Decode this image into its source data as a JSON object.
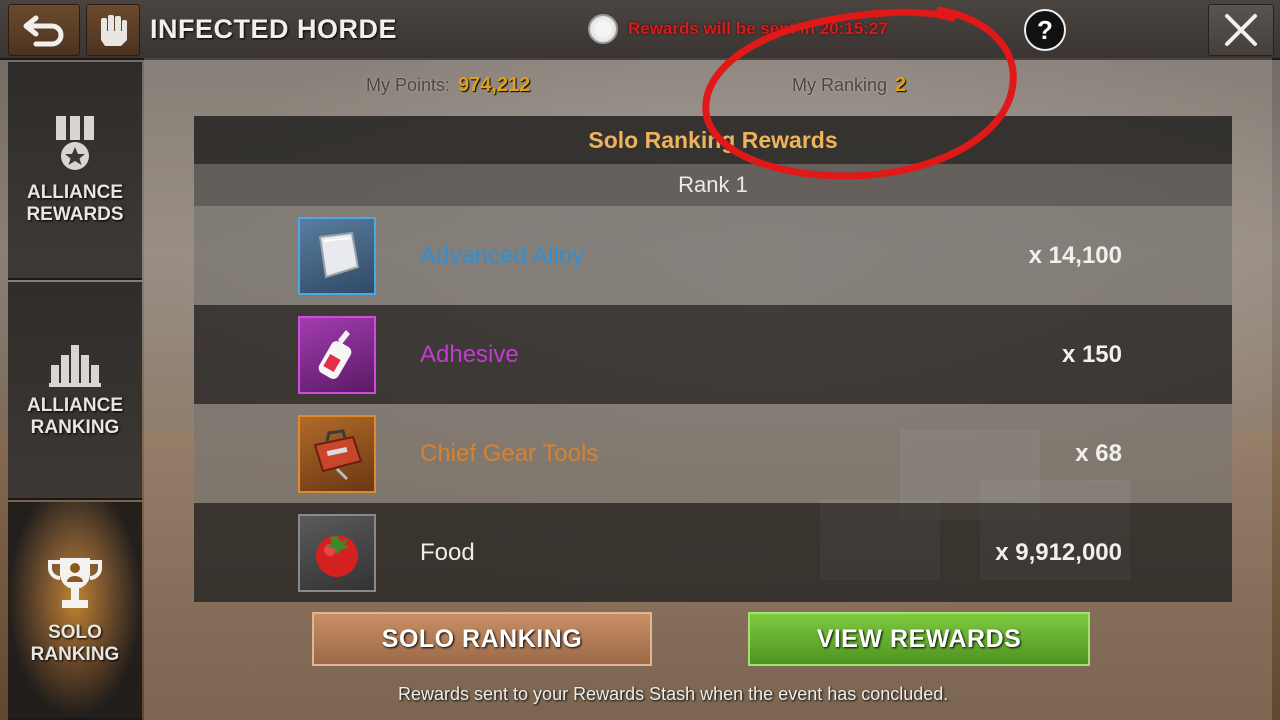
{
  "header": {
    "title": "INFECTED HORDE",
    "timer_text": "Rewards will be sent in 20:15:27",
    "help_label": "?",
    "back_icon": "back-arrow-icon",
    "event_icon": "fist-icon",
    "close_icon": "close-x-icon"
  },
  "sidebar": {
    "items": [
      {
        "label": "ALLIANCE\nREWARDS",
        "icon": "medal-icon",
        "active": false
      },
      {
        "label": "ALLIANCE\nRANKING",
        "icon": "ranking-bars-icon",
        "active": false
      },
      {
        "label": "SOLO\nRANKING",
        "icon": "trophy-icon",
        "active": true
      }
    ]
  },
  "stats": {
    "points_label": "My Points:",
    "points_value": "974,212",
    "ranking_label": "My Ranking",
    "ranking_value": "2"
  },
  "rewards": {
    "heading": "Solo Ranking Rewards",
    "rank_label": "Rank 1",
    "items": [
      {
        "name": "Advanced Alloy",
        "qty": "x 14,100",
        "color": "#2f8fd6",
        "icon": "alloy-plate-icon",
        "border": "#4aa8e8"
      },
      {
        "name": "Adhesive",
        "qty": "x 150",
        "color": "#c23ad2",
        "icon": "glue-bottle-icon",
        "border": "#d24adf"
      },
      {
        "name": "Chief Gear Tools",
        "qty": "x 68",
        "color": "#d9822b",
        "icon": "toolbox-icon",
        "border": "#e08a30"
      },
      {
        "name": "Food",
        "qty": "x 9,912,000",
        "color": "#f0eeea",
        "icon": "tomato-icon",
        "border": "#8a8a8a"
      }
    ]
  },
  "buttons": {
    "solo_ranking": "SOLO RANKING",
    "view_rewards": "VIEW REWARDS"
  },
  "footer": {
    "note": "Rewards sent to your Rewards Stash when the event has concluded."
  }
}
